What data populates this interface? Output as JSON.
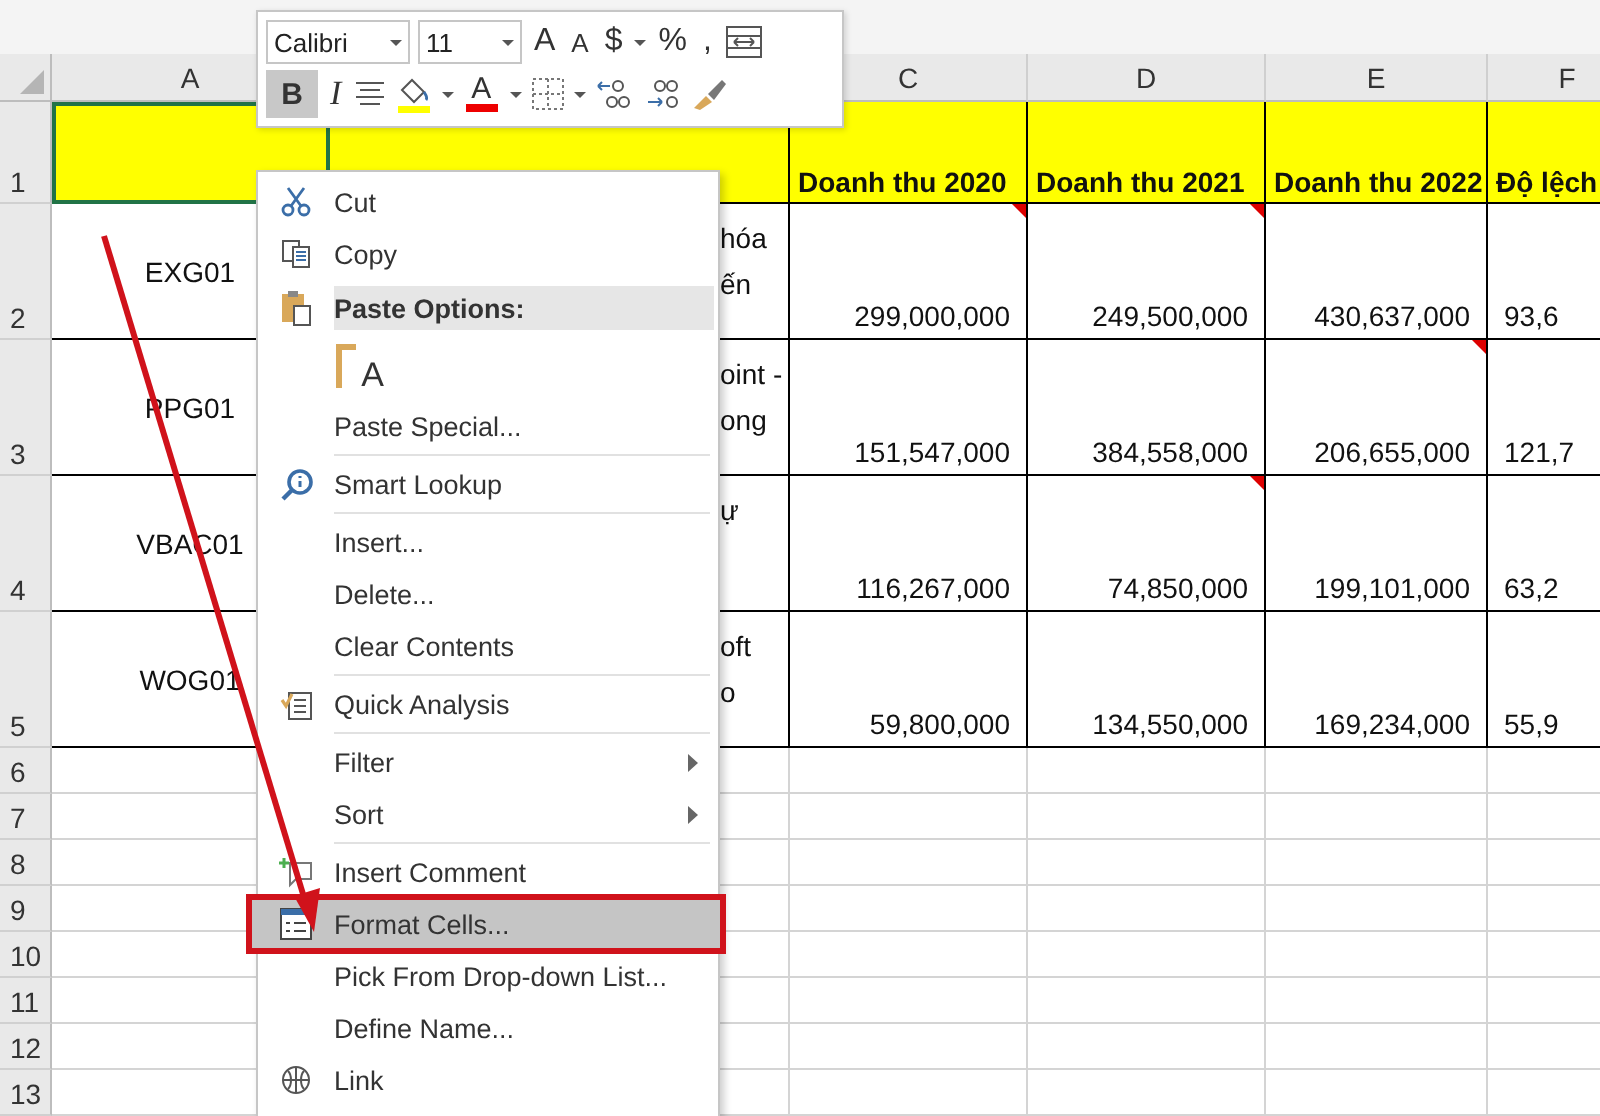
{
  "toolbar": {
    "font": "Calibri",
    "size": "11",
    "top_buttons": [
      {
        "kind": "grow-font",
        "label": "A"
      },
      {
        "kind": "shrink-font",
        "label": "A"
      },
      {
        "kind": "text",
        "label": "$"
      },
      {
        "kind": "dropdown"
      },
      {
        "kind": "text",
        "label": "%"
      },
      {
        "kind": "text",
        "label": ","
      },
      {
        "kind": "merge"
      }
    ],
    "bottom_buttons": [
      {
        "kind": "bold",
        "label": "B",
        "selected": true
      },
      {
        "kind": "italic",
        "label": "I",
        "selected": false
      },
      {
        "kind": "align"
      },
      {
        "kind": "fill"
      },
      {
        "kind": "dropdown"
      },
      {
        "kind": "font-color",
        "label": "A"
      },
      {
        "kind": "dropdown"
      },
      {
        "kind": "borders"
      },
      {
        "kind": "dropdown"
      },
      {
        "kind": "increase-decimal"
      },
      {
        "kind": "decrease-decimal"
      },
      {
        "kind": "format-painter"
      }
    ]
  },
  "sheet": {
    "columns": [
      {
        "letter": "A"
      },
      {},
      {
        "letter": "C"
      },
      {
        "letter": "D"
      },
      {
        "letter": "E"
      },
      {
        "letter": "F"
      }
    ],
    "rows": [
      {
        "number": "1",
        "kind": "header",
        "cells": [
          {
            "selected": true
          },
          {
            "selected": false
          },
          {
            "text": "Doanh thu 2020",
            "selected": false
          },
          {
            "text": "Doanh thu 2021",
            "selected": false
          },
          {
            "text": "Doanh thu 2022",
            "selected": false
          },
          {
            "text": "Độ lệch",
            "selected": false
          }
        ]
      },
      {
        "number": "2",
        "kind": "data",
        "cells": [
          {
            "text": "EXG01",
            "selected": false
          },
          {
            "lines": [
              "hóa",
              "ến"
            ],
            "selected": false
          },
          {
            "text": "299,000,000",
            "comment": true,
            "selected": false
          },
          {
            "text": "249,500,000",
            "comment": true,
            "selected": false
          },
          {
            "text": "430,637,000",
            "selected": false
          },
          {
            "text": "93,6",
            "selected": false
          }
        ]
      },
      {
        "number": "3",
        "kind": "data",
        "cells": [
          {
            "text": "PPG01",
            "selected": false
          },
          {
            "lines": [
              "oint -",
              "ong"
            ],
            "selected": false
          },
          {
            "text": "151,547,000",
            "selected": false
          },
          {
            "text": "384,558,000",
            "selected": false
          },
          {
            "text": "206,655,000",
            "comment": true,
            "selected": false
          },
          {
            "text": "121,7",
            "selected": false
          }
        ]
      },
      {
        "number": "4",
        "kind": "data",
        "cells": [
          {
            "text": "VBAC01",
            "selected": false
          },
          {
            "lines": [
              "ự"
            ],
            "selected": false
          },
          {
            "text": "116,267,000",
            "selected": false
          },
          {
            "text": "74,850,000",
            "comment": true,
            "selected": false
          },
          {
            "text": "199,101,000",
            "selected": false
          },
          {
            "text": "63,2",
            "selected": false
          }
        ]
      },
      {
        "number": "5",
        "kind": "data",
        "cells": [
          {
            "text": "WOG01",
            "selected": false
          },
          {
            "lines": [
              "oft",
              "o"
            ],
            "selected": false
          },
          {
            "text": "59,800,000",
            "selected": false
          },
          {
            "text": "134,550,000",
            "selected": false
          },
          {
            "text": "169,234,000",
            "selected": false
          },
          {
            "text": "55,9",
            "selected": false
          }
        ]
      },
      {
        "number": "6",
        "kind": "empty"
      },
      {
        "number": "7",
        "kind": "empty"
      },
      {
        "number": "8",
        "kind": "empty"
      },
      {
        "number": "9",
        "kind": "empty"
      },
      {
        "number": "10",
        "kind": "empty"
      },
      {
        "number": "11",
        "kind": "empty"
      },
      {
        "number": "12",
        "kind": "empty"
      },
      {
        "number": "13",
        "kind": "empty"
      }
    ]
  },
  "context_menu": {
    "items": [
      {
        "kind": "command",
        "label": "Cut",
        "selected": false
      },
      {
        "kind": "command",
        "label": "Copy",
        "selected": false
      },
      {
        "kind": "header",
        "label": "Paste Options:"
      },
      {
        "kind": "paste-option",
        "label": "A"
      },
      {
        "kind": "command",
        "label": "Paste Special...",
        "selected": false
      },
      {
        "kind": "separator"
      },
      {
        "kind": "command",
        "label": "Smart Lookup",
        "selected": false
      },
      {
        "kind": "separator"
      },
      {
        "kind": "command",
        "label": "Insert...",
        "selected": false
      },
      {
        "kind": "command",
        "label": "Delete...",
        "selected": false
      },
      {
        "kind": "command",
        "label": "Clear Contents",
        "selected": false
      },
      {
        "kind": "separator"
      },
      {
        "kind": "command",
        "label": "Quick Analysis",
        "selected": false
      },
      {
        "kind": "separator"
      },
      {
        "kind": "submenu",
        "label": "Filter",
        "selected": false
      },
      {
        "kind": "submenu",
        "label": "Sort",
        "selected": false
      },
      {
        "kind": "separator"
      },
      {
        "kind": "command",
        "label": "Insert Comment",
        "selected": false
      },
      {
        "kind": "command",
        "label": "Format Cells...",
        "selected": true,
        "annotated": true
      },
      {
        "kind": "command",
        "label": "Pick From Drop-down List...",
        "selected": false
      },
      {
        "kind": "command",
        "label": "Define Name...",
        "selected": false
      },
      {
        "kind": "command",
        "label": "Link",
        "selected": false
      }
    ]
  },
  "annotation": {
    "arrow": true
  }
}
